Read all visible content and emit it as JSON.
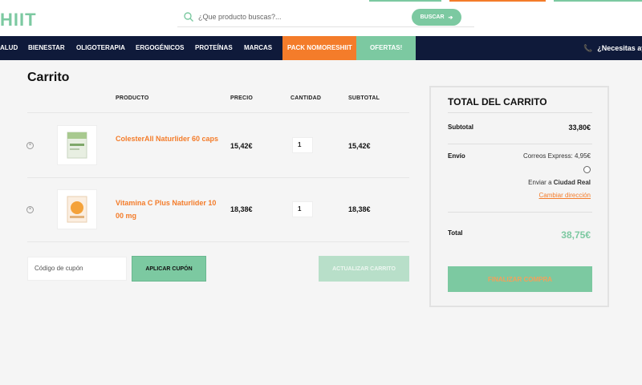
{
  "header": {
    "logo_text": "HIIT",
    "search_placeholder": "¿Que producto buscas?...",
    "search_button": "BUSCAR",
    "top_accent_colors": [
      "#7cc9a1",
      "#f47c2a",
      "#0f1a3a"
    ]
  },
  "nav": {
    "items": [
      "ALUD",
      "BIENESTAR",
      "OLIGOTERAPIA",
      "ERGOGÉNICOS",
      "PROTEÍNAS",
      "MARCAS"
    ],
    "pack": "PACK NOMORESHIIT",
    "ofertas": "OFERTAS!",
    "help": "¿Necesitas ay"
  },
  "cart": {
    "title": "Carrito",
    "columns": [
      "PRODUCTO",
      "PRECIO",
      "CANTIDAD",
      "SUBTOTAL"
    ],
    "rows": [
      {
        "name": "ColesterAll Naturlider 60 caps",
        "price": "15,42€",
        "qty": "1",
        "subtotal": "15,42€"
      },
      {
        "name": "Vitamina C Plus Naturlider 1000 mg",
        "price": "18,38€",
        "qty": "1",
        "subtotal": "18,38€"
      }
    ],
    "coupon_placeholder": "Código de cupón",
    "apply_coupon": "APLICAR CUPÓN",
    "update_cart": "ACTUALIZAR CARRITO"
  },
  "totals": {
    "title": "TOTAL DEL CARRITO",
    "subtotal_label": "Subtotal",
    "subtotal_value": "33,80€",
    "shipping_label": "Envío",
    "shipping_method": "Correos Express: 4,95€",
    "ship_to_prefix": "Enviar a",
    "ship_to_city": "Ciudad Real",
    "change_address": "Cambiar dirección",
    "total_label": "Total",
    "total_value": "38,75€",
    "checkout": "FINALIZAR COMPRA"
  },
  "colors": {
    "accent_green": "#7cc9a1",
    "accent_orange": "#f47c2a",
    "navy": "#0f1a3a"
  }
}
